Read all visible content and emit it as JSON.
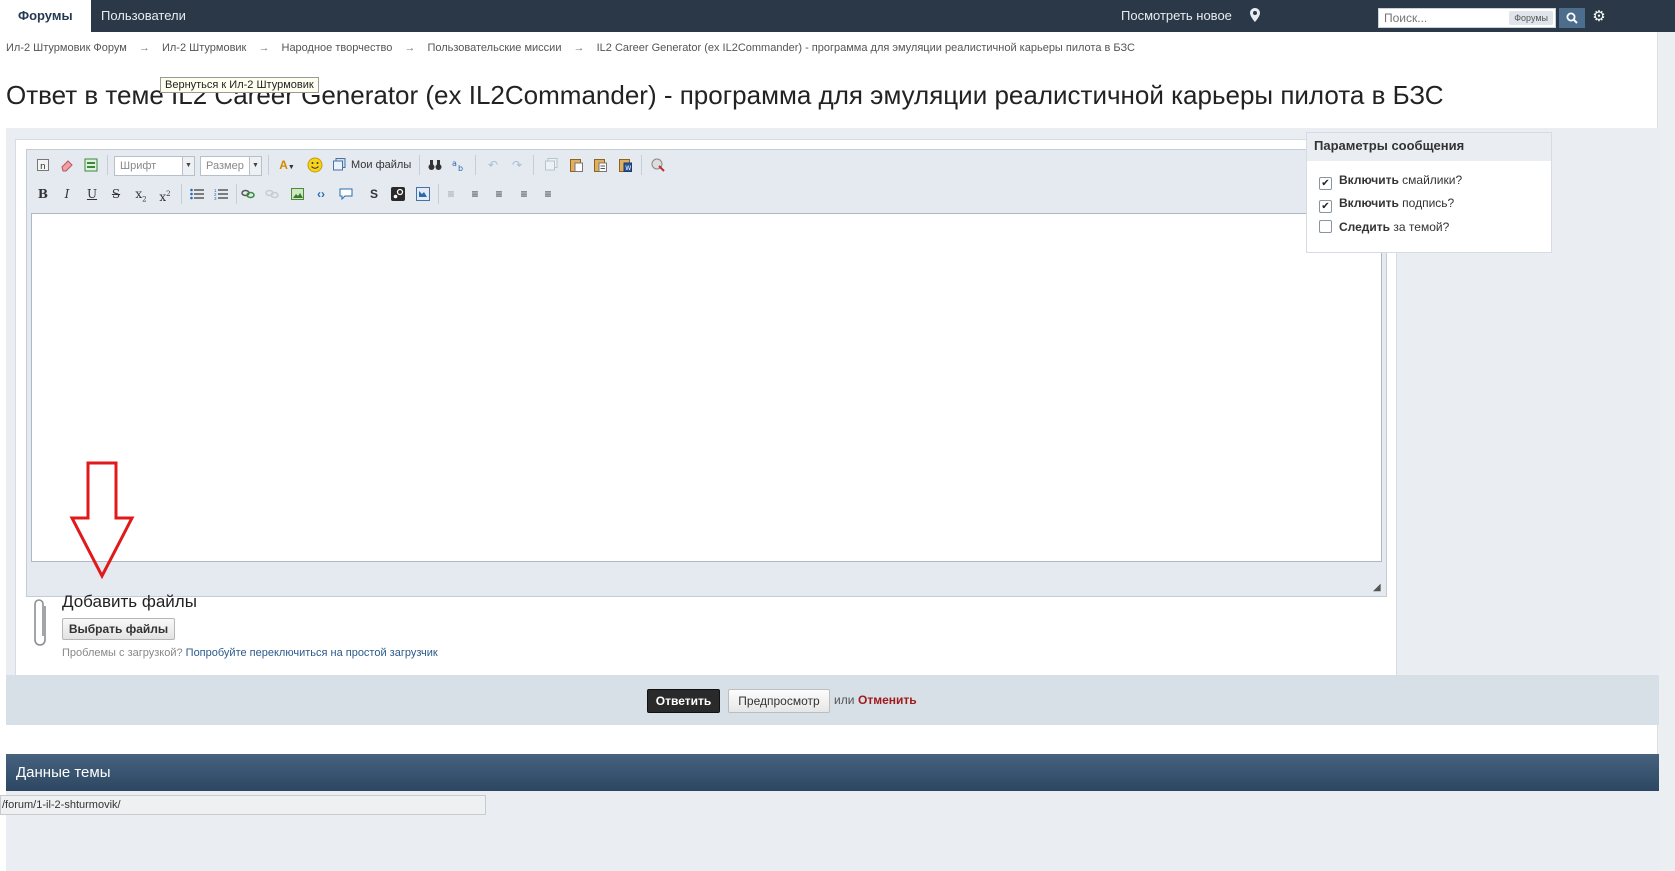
{
  "nav": {
    "tabs": [
      {
        "label": "Форумы",
        "active": true
      },
      {
        "label": "Пользователи",
        "active": false
      }
    ],
    "view_new": "Посмотреть новое",
    "location_icon": "map-marker-icon",
    "search_placeholder": "Поиск...",
    "search_scope": "Форумы",
    "search_icon": "search-icon",
    "settings_icon": "gear-icon"
  },
  "breadcrumb": [
    "Ил-2 Штурмовик Форум",
    "Ил-2 Штурмовик",
    "Народное творчество",
    "Пользовательские миссии",
    "IL2 Career Generator (ex IL2Commander) - программа для эмуляции реалистичной карьеры пилота в БЗС"
  ],
  "breadcrumb_separator": "→",
  "tooltip": "Вернуться к  Ил-2 Штурмовик",
  "page_title": "Ответ в теме IL2 Career Generator (ex IL2Commander) - программа для эмуляции реалистичной карьеры пилота в БЗС",
  "editor": {
    "font_select": "Шрифт",
    "size_select": "Размер",
    "my_files": "Мои файлы",
    "body_text": ""
  },
  "attachments": {
    "title": "Добавить файлы",
    "choose_button": "Выбрать файлы",
    "help_text": "Проблемы с загрузкой?",
    "help_link": "Попробуйте переключиться на простой загрузчик"
  },
  "options": {
    "title": "Параметры сообщения",
    "items": [
      {
        "bold": "Включить",
        "rest": " смайлики?",
        "checked": true,
        "mark": "✔"
      },
      {
        "bold": "Включить",
        "rest": " подпись?",
        "checked": true,
        "mark": "✔"
      },
      {
        "bold": "Следить",
        "rest": " за темой?",
        "checked": false,
        "mark": ""
      }
    ]
  },
  "actions": {
    "reply": "Ответить",
    "preview": "Предпросмотр",
    "or": "или",
    "cancel": "Отменить"
  },
  "topic_data": {
    "title": "Данные темы"
  },
  "status_url": "/forum/1-il-2-shturmovik/",
  "colors": {
    "navbar": "#2b3847",
    "accent_blue": "#4d6d8d",
    "cancel_red": "#a01a1a",
    "annotation_arrow": "#e0191b"
  }
}
